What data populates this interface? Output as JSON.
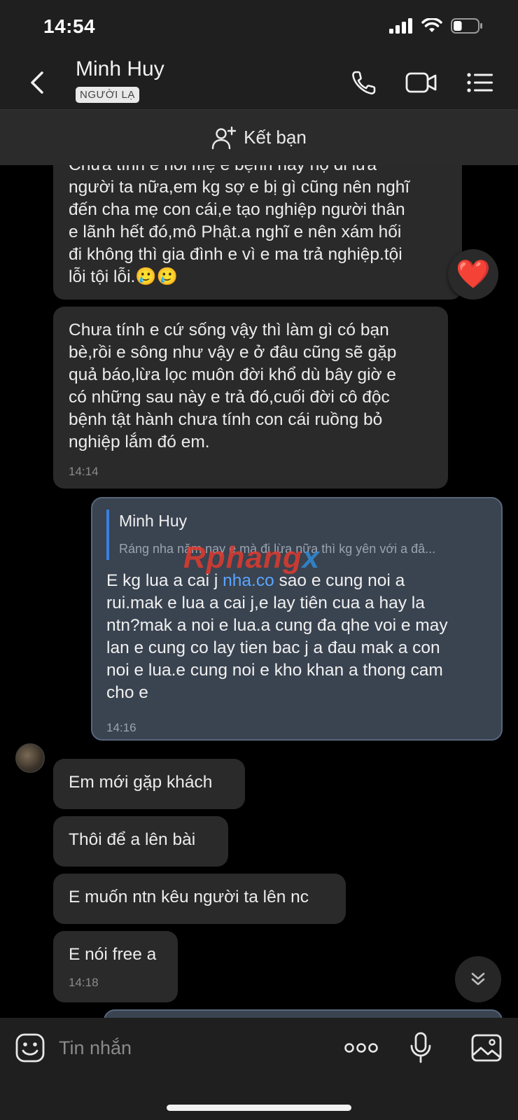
{
  "status_bar": {
    "time": "14:54",
    "battery_level": 0.35
  },
  "header": {
    "name": "Minh Huy",
    "badge": "NGƯỜI LẠ"
  },
  "friend_bar": {
    "label": "Kết bạn"
  },
  "messages": {
    "m1": {
      "text": "Chưa tính e nói mẹ e bệnh hay họ đi lừa\nngười ta nữa,em kg sợ e bị gì cũng nên nghĩ\nđến cha mẹ con cái,e tạo nghiệp người thân\ne lãnh hết đó,mô Phật.a nghĩ e nên xám hối\nđi không thì gia đình e vì e ma trả nghiệp.tội\nlỗi tội lỗi.🥲🥲",
      "reaction": "❤️"
    },
    "m2": {
      "text": "Chưa tính e cứ sống vậy thì làm gì có bạn\nbè,rồi e sông như vậy e ở đâu cũng sẽ gặp\nquả báo,lừa lọc muôn đời khổ dù bây giờ e\ncó những sau này e trả đó,cuối đời cô độc\nbệnh tật hành chưa tính  con cái ruồng bỏ\nnghiệp lắm đó em.",
      "time": "14:14"
    },
    "m3": {
      "quote_name": "Minh Huy",
      "quote_text": "Ráng nha năm nay e mà đi lừa nữa thì kg yên với a đâ...",
      "text_before": "E kg lua a cai j ",
      "link": "nha.co",
      "text_after": " sao e cung noi a\nrui.mak e lua a cai j,e lay tiên cua a hay la\nntn?mak a noi e lua.a cung đa qhe voi e may\nlan e cung co lay tien bac j a đau mak a con\nnoi e lua.e cung noi e kho khan a thong cam\ncho e",
      "time": "14:16"
    },
    "m4": {
      "text": "Em mới gặp khách"
    },
    "m5": {
      "text": "Thôi để a lên bài"
    },
    "m6": {
      "text": "E muốn ntn kêu người ta lên nc"
    },
    "m7": {
      "text": "E nói free a",
      "time": "14:18"
    }
  },
  "watermark": {
    "main": "Rphang",
    "accent": "x"
  },
  "input": {
    "placeholder": "Tin nhắn"
  },
  "icons": [
    "back-icon",
    "phone-icon",
    "video-icon",
    "menu-icon",
    "add-friend-icon",
    "heart-icon",
    "chevron-double-down-icon",
    "sticker-icon",
    "more-icon",
    "mic-icon",
    "image-icon"
  ],
  "colors": {
    "accent_blue": "#3b7fe0",
    "link": "#5aa5ff",
    "bubble_in": "#2a2a2a",
    "bubble_out": "#3a4350"
  }
}
